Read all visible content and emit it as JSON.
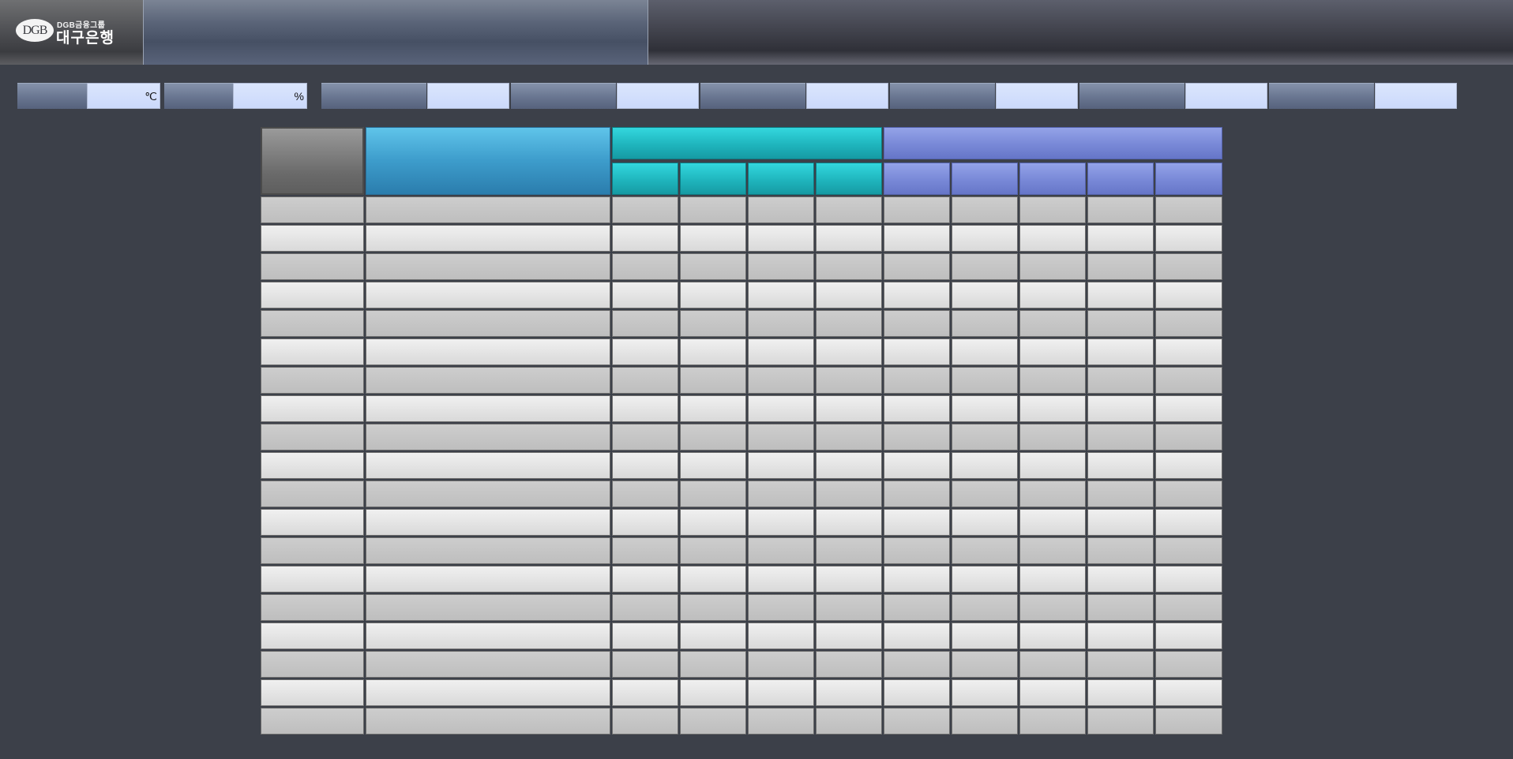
{
  "header": {
    "logo_mark": "DGB",
    "logo_subtitle": "DGB금융그룹",
    "logo_name": "대구은행",
    "title": ""
  },
  "info_bar": {
    "temperature": {
      "label": "",
      "value": "",
      "unit": "℃"
    },
    "humidity": {
      "label": "",
      "value": "",
      "unit": "%"
    },
    "fields": [
      {
        "label": "",
        "value": ""
      },
      {
        "label": "",
        "value": ""
      },
      {
        "label": "",
        "value": ""
      },
      {
        "label": "",
        "value": ""
      },
      {
        "label": "",
        "value": ""
      },
      {
        "label": "",
        "value": ""
      }
    ]
  },
  "table": {
    "headers": {
      "col1": "",
      "col2": "",
      "group_teal": {
        "label": "",
        "subs": [
          "",
          "",
          "",
          ""
        ]
      },
      "group_purple": {
        "label": "",
        "subs": [
          "",
          "",
          "",
          "",
          ""
        ]
      }
    },
    "rows": [
      [
        "",
        "",
        "",
        "",
        "",
        "",
        "",
        "",
        "",
        "",
        ""
      ],
      [
        "",
        "",
        "",
        "",
        "",
        "",
        "",
        "",
        "",
        "",
        ""
      ],
      [
        "",
        "",
        "",
        "",
        "",
        "",
        "",
        "",
        "",
        "",
        ""
      ],
      [
        "",
        "",
        "",
        "",
        "",
        "",
        "",
        "",
        "",
        "",
        ""
      ],
      [
        "",
        "",
        "",
        "",
        "",
        "",
        "",
        "",
        "",
        "",
        ""
      ],
      [
        "",
        "",
        "",
        "",
        "",
        "",
        "",
        "",
        "",
        "",
        ""
      ],
      [
        "",
        "",
        "",
        "",
        "",
        "",
        "",
        "",
        "",
        "",
        ""
      ],
      [
        "",
        "",
        "",
        "",
        "",
        "",
        "",
        "",
        "",
        "",
        ""
      ],
      [
        "",
        "",
        "",
        "",
        "",
        "",
        "",
        "",
        "",
        "",
        ""
      ],
      [
        "",
        "",
        "",
        "",
        "",
        "",
        "",
        "",
        "",
        "",
        ""
      ],
      [
        "",
        "",
        "",
        "",
        "",
        "",
        "",
        "",
        "",
        "",
        ""
      ],
      [
        "",
        "",
        "",
        "",
        "",
        "",
        "",
        "",
        "",
        "",
        ""
      ],
      [
        "",
        "",
        "",
        "",
        "",
        "",
        "",
        "",
        "",
        "",
        ""
      ],
      [
        "",
        "",
        "",
        "",
        "",
        "",
        "",
        "",
        "",
        "",
        ""
      ],
      [
        "",
        "",
        "",
        "",
        "",
        "",
        "",
        "",
        "",
        "",
        ""
      ],
      [
        "",
        "",
        "",
        "",
        "",
        "",
        "",
        "",
        "",
        "",
        ""
      ],
      [
        "",
        "",
        "",
        "",
        "",
        "",
        "",
        "",
        "",
        "",
        ""
      ],
      [
        "",
        "",
        "",
        "",
        "",
        "",
        "",
        "",
        "",
        "",
        ""
      ],
      [
        "",
        "",
        "",
        "",
        "",
        "",
        "",
        "",
        "",
        "",
        ""
      ]
    ]
  },
  "colors": {
    "background": "#3c4049",
    "teal_header": "#1fb5bd",
    "purple_header": "#7888d7",
    "blue_header": "#3d9ccb"
  }
}
